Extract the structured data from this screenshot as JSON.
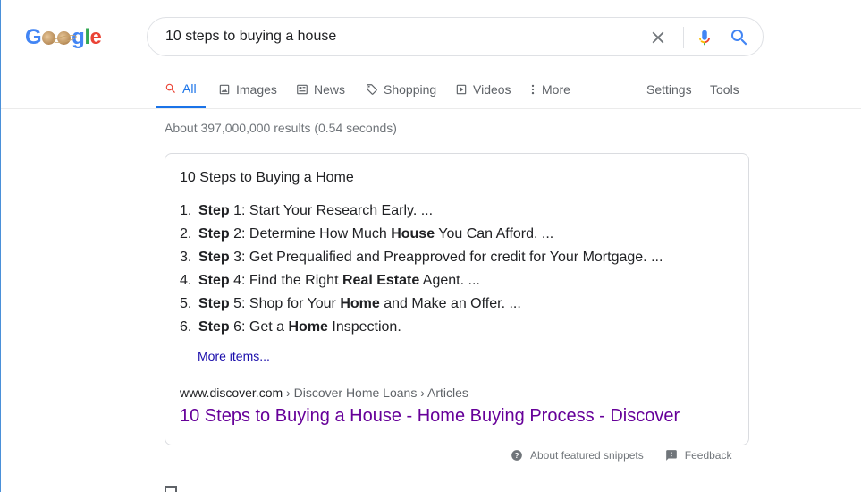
{
  "logo": {
    "text": "Google"
  },
  "search": {
    "query": "10 steps to buying a house"
  },
  "tabs": {
    "all": "All",
    "images": "Images",
    "news": "News",
    "shopping": "Shopping",
    "videos": "Videos",
    "more": "More",
    "settings": "Settings",
    "tools": "Tools"
  },
  "result_stats": "About 397,000,000 results (0.54 seconds)",
  "snippet": {
    "title": "10 Steps to Buying a Home",
    "steps": [
      {
        "num": "1.",
        "bold": "Step",
        "text_a": " 1: Start Your Research Early. ...",
        "bold2": "",
        "text_b": ""
      },
      {
        "num": "2.",
        "bold": "Step",
        "text_a": " 2: Determine How Much ",
        "bold2": "House",
        "text_b": " You Can Afford. ..."
      },
      {
        "num": "3.",
        "bold": "Step",
        "text_a": " 3: Get Prequalified and Preapproved for credit for Your Mortgage. ...",
        "bold2": "",
        "text_b": ""
      },
      {
        "num": "4.",
        "bold": "Step",
        "text_a": " 4: Find the Right ",
        "bold2": "Real Estate",
        "text_b": " Agent. ..."
      },
      {
        "num": "5.",
        "bold": "Step",
        "text_a": " 5: Shop for Your ",
        "bold2": "Home",
        "text_b": " and Make an Offer. ..."
      },
      {
        "num": "6.",
        "bold": "Step",
        "text_a": " 6: Get a ",
        "bold2": "Home",
        "text_b": " Inspection."
      }
    ],
    "more_items": "More items...",
    "cite_domain": "www.discover.com",
    "cite_path": " › Discover Home Loans › Articles",
    "link_title": "10 Steps to Buying a House - Home Buying Process - Discover"
  },
  "snippet_footer": {
    "about": "About featured snippets",
    "feedback": "Feedback"
  },
  "colors": {
    "accent": "#1a73e8",
    "visited_link": "#660099",
    "link": "#1a0dab",
    "muted": "#70757a"
  }
}
